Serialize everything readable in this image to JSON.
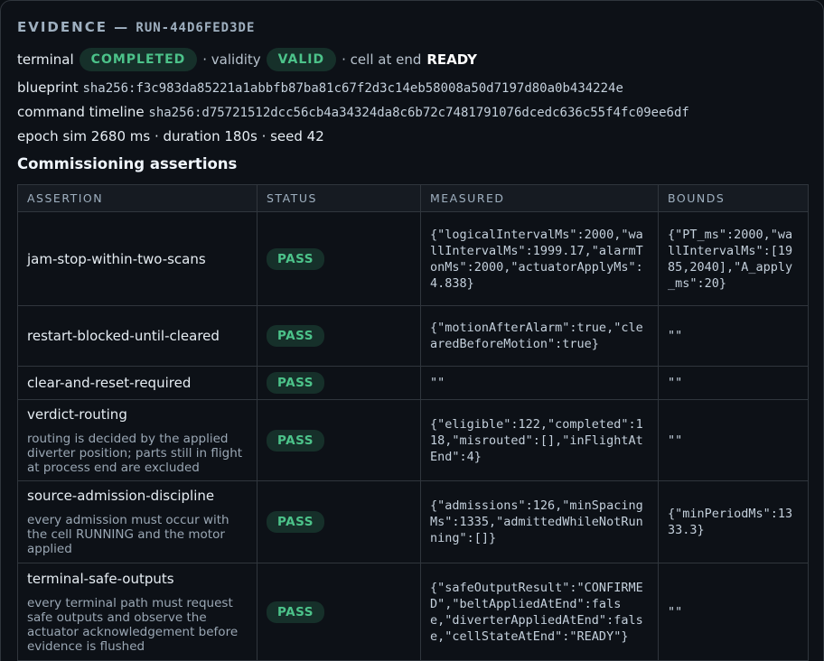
{
  "header": {
    "label": "EVIDENCE — ",
    "run_id": "RUN-44D6FED3DE"
  },
  "summary": {
    "terminal_label": "terminal",
    "terminal_value": "COMPLETED",
    "validity_label": "· validity",
    "validity_value": "VALID",
    "cell_label": "· cell at end",
    "cell_value": "READY",
    "blueprint_label": "blueprint",
    "blueprint_hash": "sha256:f3c983da85221a1abbfb87ba81c67f2d3c14eb58008a50d7197d80a0b434224e",
    "timeline_label": "command timeline",
    "timeline_hash": "sha256:d75721512dcc56cb4a34324da8c6b72c7481791076dcedc636c55f4fc09ee6df",
    "meta_line": "epoch sim 2680 ms · duration 180s · seed 42"
  },
  "assertions_title": "Commissioning assertions",
  "table": {
    "headers": [
      "ASSERTION",
      "STATUS",
      "MEASURED",
      "BOUNDS"
    ],
    "rows": [
      {
        "name": "jam-stop-within-two-scans",
        "desc": "",
        "status": "PASS",
        "measured": "{\"logicalIntervalMs\":2000,\"wallIntervalMs\":1999.17,\"alarmTonMs\":2000,\"actuatorApplyMs\":4.838}",
        "bounds": "{\"PT_ms\":2000,\"wallIntervalMs\":[1985,2040],\"A_apply_ms\":20}"
      },
      {
        "name": "restart-blocked-until-cleared",
        "desc": "",
        "status": "PASS",
        "measured": "{\"motionAfterAlarm\":true,\"clearedBeforeMotion\":true}",
        "bounds": "\"\""
      },
      {
        "name": "clear-and-reset-required",
        "desc": "",
        "status": "PASS",
        "measured": "\"\"",
        "bounds": "\"\""
      },
      {
        "name": "verdict-routing",
        "desc": "routing is decided by the applied diverter position; parts still in flight at process end are excluded",
        "status": "PASS",
        "measured": "{\"eligible\":122,\"completed\":118,\"misrouted\":[],\"inFlightAtEnd\":4}",
        "bounds": "\"\""
      },
      {
        "name": "source-admission-discipline",
        "desc": "every admission must occur with the cell RUNNING and the motor applied",
        "status": "PASS",
        "measured": "{\"admissions\":126,\"minSpacingMs\":1335,\"admittedWhileNotRunning\":[]}",
        "bounds": "{\"minPeriodMs\":1333.3}"
      },
      {
        "name": "terminal-safe-outputs",
        "desc": "every terminal path must request safe outputs and observe the actuator acknowledgement before evidence is flushed",
        "status": "PASS",
        "measured": "{\"safeOutputResult\":\"CONFIRMED\",\"beltAppliedAtEnd\":false,\"diverterAppliedAtEnd\":false,\"cellStateAtEnd\":\"READY\"}",
        "bounds": "\"\""
      }
    ]
  }
}
